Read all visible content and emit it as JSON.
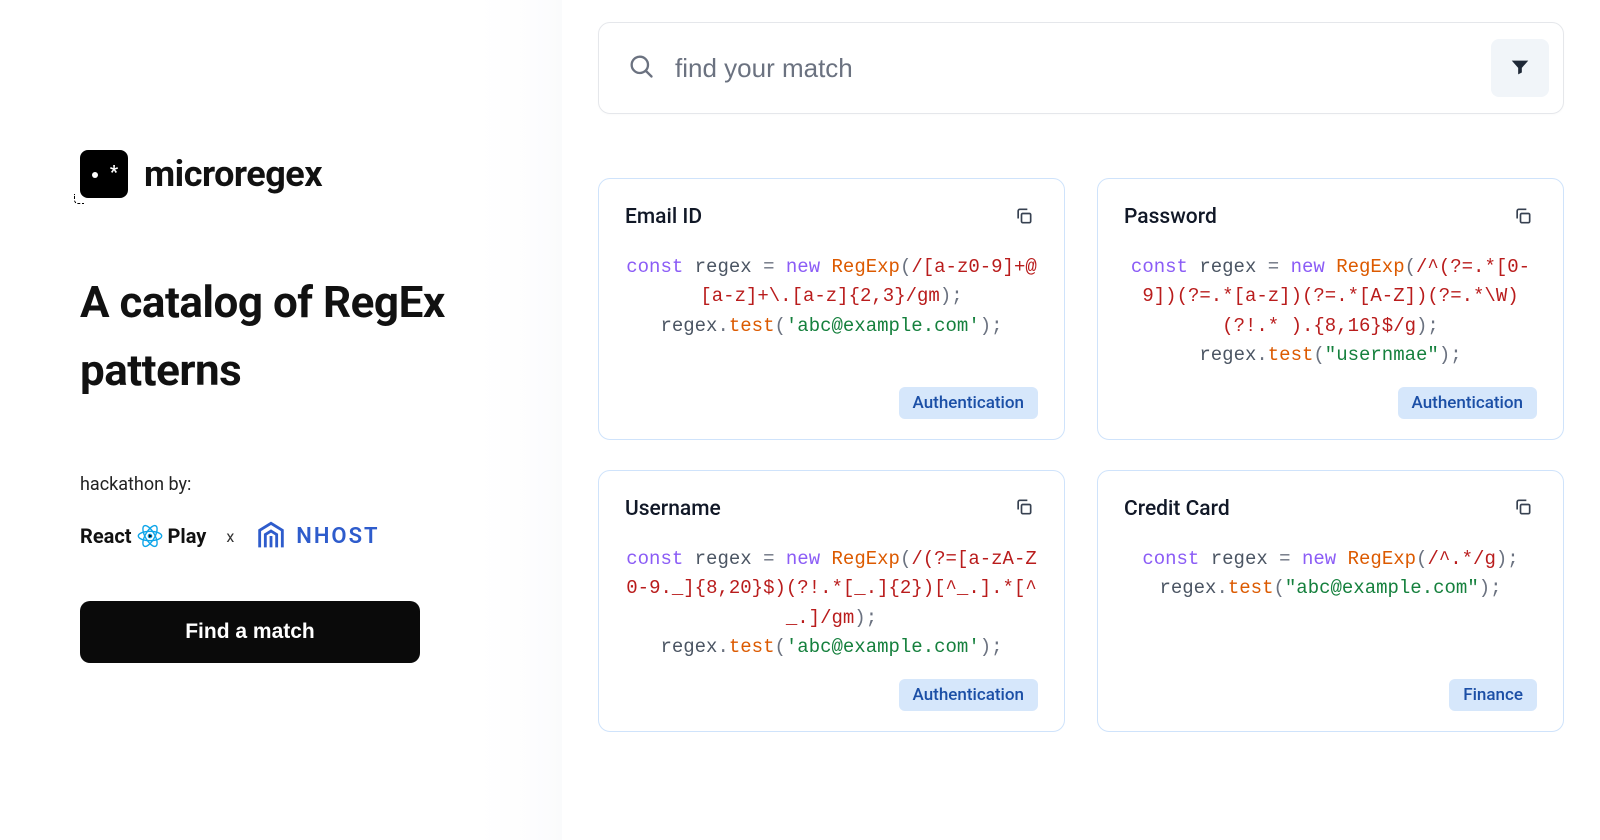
{
  "sidebar": {
    "brand": "microregex",
    "headline": "A catalog of RegEx patterns",
    "hackathon_label": "hackathon by:",
    "sponsor1_part1": "React",
    "sponsor1_part2": "Play",
    "sponsor_sep": "x",
    "sponsor2": "NHOST",
    "cta": "Find a match"
  },
  "search": {
    "placeholder": "find your match"
  },
  "code_tokens": {
    "const": "const",
    "new": "new",
    "regexp": "RegExp",
    "regex_ident": "regex",
    "test": "test",
    "eq": " = ",
    "open": "(",
    "close": ")",
    "semi": ";",
    "dot": "."
  },
  "cards": [
    {
      "title": "Email ID",
      "pattern": "/[a-z0-9]+@[a-z]+\\.[a-z]{2,3}/gm",
      "test_str": "'abc@example.com'",
      "tag": "Authentication"
    },
    {
      "title": "Password",
      "pattern": "/^(?=.*[0-9])(?=.*[a-z])(?=.*[A-Z])(?=.*\\W)(?!.* ).{8,16}$/g",
      "test_str": "\"usernmae\"",
      "tag": "Authentication"
    },
    {
      "title": "Username",
      "pattern": "/(?=[a-zA-Z0-9._]{8,20}$)(?!.*[_.]{2})[^_.].*[^_.]/gm",
      "test_str": "'abc@example.com'",
      "tag": "Authentication"
    },
    {
      "title": "Credit Card",
      "pattern": "/^.*/g",
      "test_str": "\"abc@example.com\"",
      "tag": "Finance"
    }
  ]
}
